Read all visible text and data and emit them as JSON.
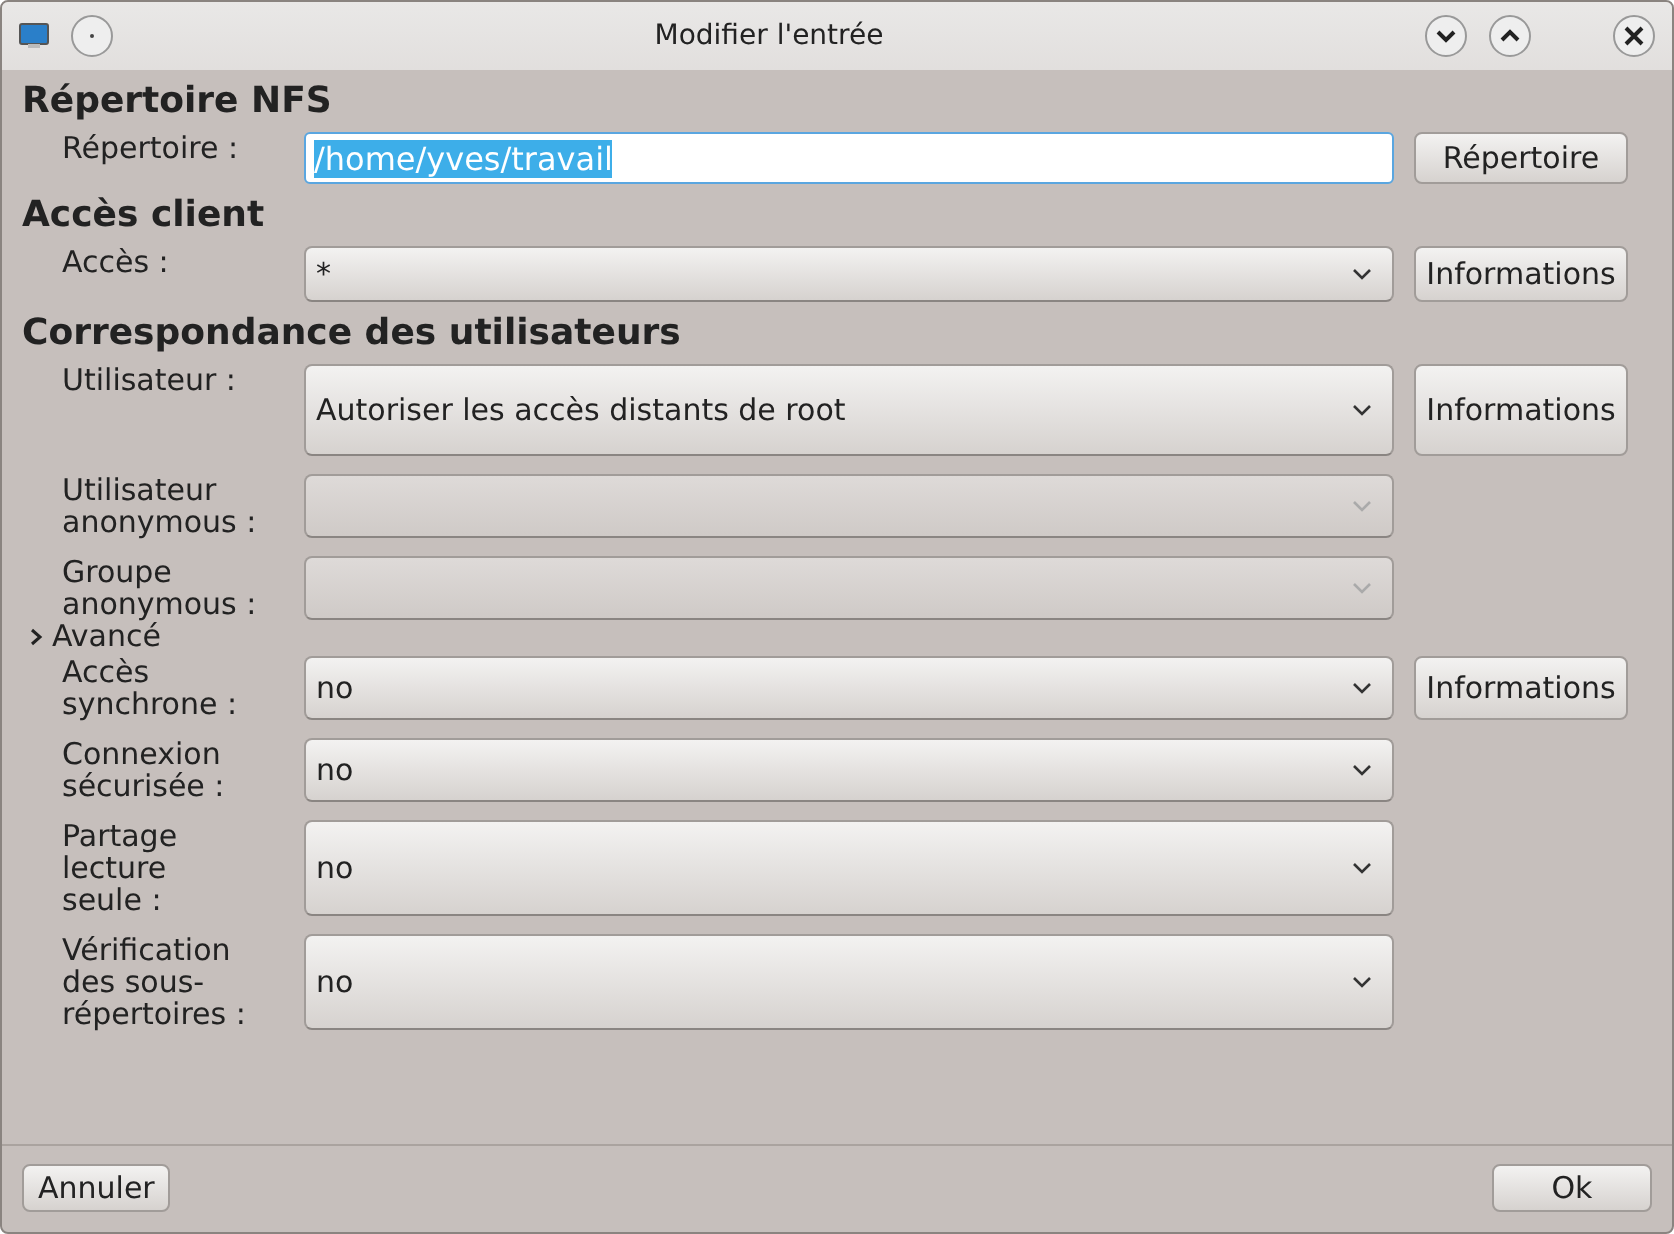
{
  "window": {
    "title": "Modifier l'entrée"
  },
  "sections": [
    {
      "kind": "heading",
      "title": "Répertoire NFS",
      "rows": [
        {
          "kind": "text",
          "label": [
            "Répertoire :"
          ],
          "value": "/home/yves/travail",
          "text_selected": true,
          "button": "Répertoire"
        }
      ]
    },
    {
      "kind": "heading",
      "title": "Accès client",
      "rows": [
        {
          "kind": "combo",
          "label": [
            "Accès :"
          ],
          "value": "*",
          "disabled": false,
          "button": "Informations"
        }
      ]
    },
    {
      "kind": "heading",
      "title": "Correspondance des utilisateurs",
      "rows": [
        {
          "kind": "combo",
          "label": [
            "Utilisateur :"
          ],
          "value": "Autoriser les accès distants de root",
          "disabled": false,
          "button": "Informations"
        },
        {
          "kind": "combo",
          "label": [
            "Utilisateur",
            "anonymous :"
          ],
          "disabled": true
        },
        {
          "kind": "combo",
          "label": [
            "Groupe",
            "anonymous :"
          ],
          "disabled": true
        }
      ]
    },
    {
      "kind": "expander",
      "title": "Avancé",
      "rows": [
        {
          "kind": "combo",
          "label": [
            "Accès",
            "synchrone :"
          ],
          "value": "no",
          "disabled": false,
          "button": "Informations"
        },
        {
          "kind": "combo",
          "label": [
            "Connexion",
            "sécurisée :"
          ],
          "value": "no",
          "disabled": false
        },
        {
          "kind": "combo",
          "label": [
            "Partage",
            "lecture",
            "seule :"
          ],
          "value": "no",
          "disabled": false
        },
        {
          "kind": "combo",
          "label": [
            "Vérification",
            "des sous-",
            "répertoires :"
          ],
          "value": "no",
          "disabled": false
        }
      ]
    }
  ],
  "footer": {
    "cancel": "Annuler",
    "ok": "Ok"
  }
}
